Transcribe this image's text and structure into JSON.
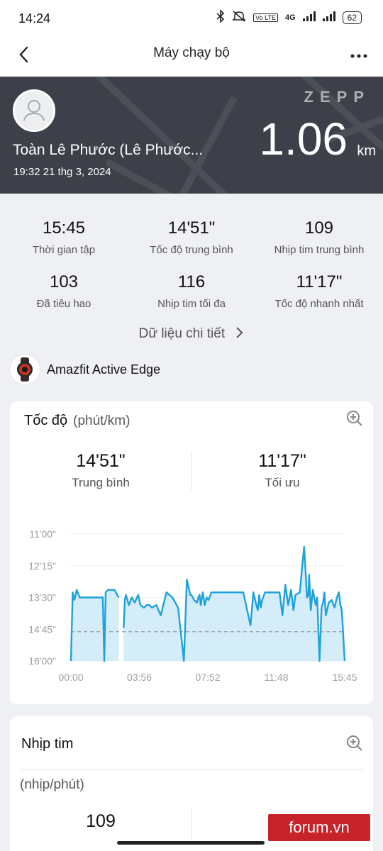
{
  "status": {
    "time": "14:24",
    "battery": "62",
    "network": "4G"
  },
  "nav": {
    "title": "Máy chạy bộ"
  },
  "hero": {
    "name": "Toàn Lê Phước (Lê Phước...",
    "datetime": "19:32 21 thg 3, 2024",
    "brand": "ZEPP",
    "distance": "1.06",
    "distance_unit": "km"
  },
  "stats": [
    {
      "value": "15:45",
      "label": "Thời gian tập"
    },
    {
      "value": "14'51\"",
      "label": "Tốc độ trung bình"
    },
    {
      "value": "109",
      "label": "Nhịp tim trung bình"
    },
    {
      "value": "103",
      "label": "Đã tiêu hao"
    },
    {
      "value": "116",
      "label": "Nhịp tim tối đa"
    },
    {
      "value": "11'17\"",
      "label": "Tốc độ nhanh nhất"
    }
  ],
  "detail_link": "Dữ liệu chi tiết",
  "device": {
    "name": "Amazfit Active Edge"
  },
  "pace_card": {
    "title": "Tốc độ",
    "unit": "(phút/km)",
    "avg_value": "14'51\"",
    "avg_label": "Trung bình",
    "best_value": "11'17\"",
    "best_label": "Tối ưu"
  },
  "chart_data": {
    "type": "area",
    "y_tick_labels": [
      "11'00\"",
      "12'15\"",
      "13'30\"",
      "14'45\"",
      "16'00\""
    ],
    "x_tick_labels": [
      "00:00",
      "03:56",
      "07:52",
      "11:48",
      "15:45"
    ],
    "y_axis_reversed": true,
    "y_unit": "min/km",
    "ylim": [
      11.0,
      16.0
    ],
    "xlim_seconds": [
      0,
      945
    ],
    "average_line": 14.85,
    "x_seconds": [
      0,
      6,
      12,
      20,
      30,
      40,
      60,
      80,
      100,
      110,
      115,
      120,
      128,
      135,
      150,
      165,
      175,
      182,
      186,
      190,
      200,
      210,
      220,
      232,
      240,
      252,
      262,
      270,
      280,
      295,
      310,
      330,
      350,
      370,
      390,
      400,
      408,
      412,
      416,
      425,
      435,
      440,
      444,
      448,
      455,
      462,
      468,
      475,
      485,
      500,
      515,
      525,
      545,
      560,
      575,
      595,
      620,
      630,
      640,
      645,
      650,
      655,
      660,
      670,
      680,
      700,
      720,
      730,
      740,
      750,
      755,
      760,
      768,
      775,
      790,
      798,
      805,
      815,
      820,
      822,
      828,
      835,
      845,
      850,
      858,
      865,
      870,
      875,
      880,
      890,
      900,
      910,
      918,
      925,
      930,
      935,
      945
    ],
    "series": [
      {
        "values": [
          16.0,
          13.3,
          13.6,
          13.2,
          13.5,
          13.5,
          13.5,
          13.5,
          13.5,
          13.5,
          16.0,
          13.3,
          13.2,
          13.2,
          13.2,
          13.5,
          null,
          14.7,
          13.6,
          13.4,
          13.8,
          13.5,
          13.7,
          13.4,
          13.8,
          13.9,
          13.8,
          13.8,
          13.9,
          13.8,
          14.2,
          13.3,
          13.5,
          13.9,
          16.0,
          12.8,
          13.2,
          13.4,
          13.4,
          13.6,
          13.7,
          13.5,
          13.4,
          13.8,
          13.3,
          13.8,
          13.5,
          13.6,
          13.3,
          13.3,
          13.3,
          13.3,
          13.3,
          13.3,
          13.3,
          13.3,
          14.6,
          13.3,
          13.8,
          14.0,
          13.4,
          13.9,
          13.6,
          13.3,
          13.3,
          13.3,
          13.3,
          14.2,
          13.0,
          13.8,
          13.5,
          13.2,
          14.0,
          13.4,
          13.3,
          12.3,
          11.5,
          13.5,
          13.4,
          12.6,
          14.0,
          13.2,
          13.8,
          13.5,
          16.0,
          13.9,
          13.7,
          13.3,
          14.2,
          13.7,
          13.6,
          13.9,
          13.5,
          13.3,
          13.8,
          14.0,
          16.0
        ]
      }
    ]
  },
  "hr_card": {
    "title": "Nhịp tim",
    "unit": "(nhịp/phút)",
    "avg_value": "109"
  },
  "watermark": "forum.vn",
  "colors": {
    "accent": "#1da1dd",
    "hero_bg": "#3d4048",
    "area_fill": "#cdeaf8"
  }
}
